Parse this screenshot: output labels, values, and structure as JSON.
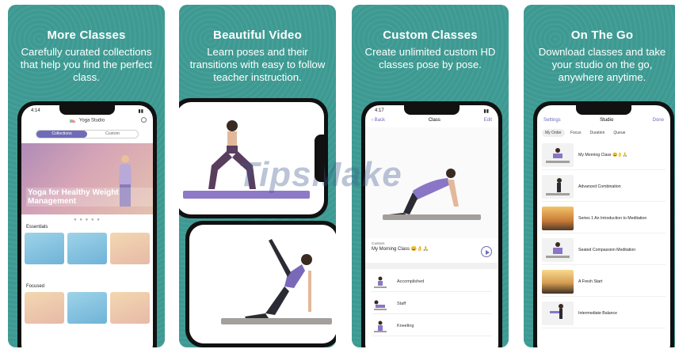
{
  "panels": [
    {
      "heading": "More Classes",
      "subtitle": "Carefully curated collections that help you find the perfect class."
    },
    {
      "heading": "Beautiful Video",
      "subtitle": "Learn poses and their transitions with easy to follow teacher instruction."
    },
    {
      "heading": "Custom Classes",
      "subtitle": "Create unlimited custom HD classes pose by pose."
    },
    {
      "heading": "On The Go",
      "subtitle": "Download classes and take your studio on the go, anywhere anytime."
    }
  ],
  "screen1": {
    "time": "4:14",
    "app_title": "Yoga Studio",
    "tabs": [
      "Collections",
      "Custom"
    ],
    "hero_title": "Yoga for Healthy Weight Management",
    "section1": "Essentials",
    "section2": "Focused"
  },
  "screen3": {
    "time": "4:17",
    "back": "Back",
    "title": "Class",
    "edit": "Edit",
    "caption_small": "Custom",
    "class_name": "My Morning Class 😀👌🙏",
    "poses": [
      "Accomplished",
      "Staff",
      "Kneeling"
    ]
  },
  "screen4": {
    "settings": "Settings",
    "title": "Studio",
    "done": "Done",
    "chips": [
      "My Order",
      "Focus",
      "Duration",
      "Queue"
    ],
    "items": [
      {
        "title": "My Morning Class 😀👌🙏"
      },
      {
        "title": "Advanced Combination"
      },
      {
        "title": "Series 1 An Introduction to Meditation"
      },
      {
        "title": "Seated Compassion Meditation"
      },
      {
        "title": "A Fresh Start"
      },
      {
        "title": "Intermediate Balance"
      }
    ]
  },
  "watermark": "TipsMake",
  "colors": {
    "panel_bg": "#3d9a92",
    "accent": "#6f6bb8",
    "mat": "#8e78c8"
  }
}
